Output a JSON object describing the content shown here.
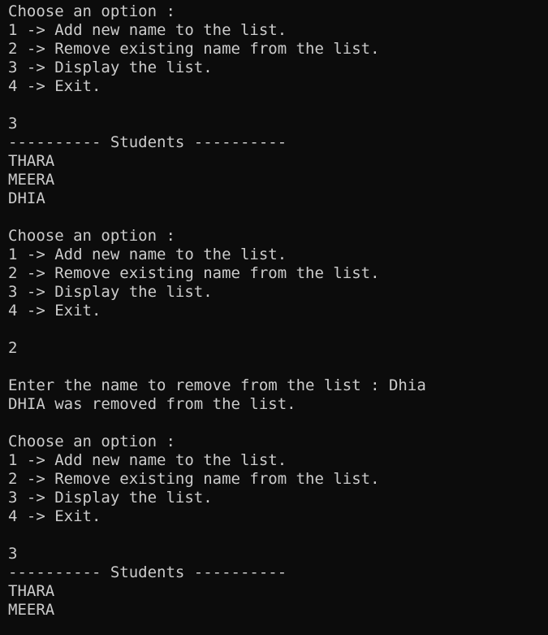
{
  "terminal": {
    "lines": [
      "Choose an option :",
      "1 -> Add new name to the list.",
      "2 -> Remove existing name from the list.",
      "3 -> Display the list.",
      "4 -> Exit.",
      "",
      "3",
      "---------- Students ----------",
      "THARA",
      "MEERA",
      "DHIA",
      "",
      "Choose an option :",
      "1 -> Add new name to the list.",
      "2 -> Remove existing name from the list.",
      "3 -> Display the list.",
      "4 -> Exit.",
      "",
      "2",
      "",
      "Enter the name to remove from the list : Dhia",
      "DHIA was removed from the list.",
      "",
      "Choose an option :",
      "1 -> Add new name to the list.",
      "2 -> Remove existing name from the list.",
      "3 -> Display the list.",
      "4 -> Exit.",
      "",
      "3",
      "---------- Students ----------",
      "THARA",
      "MEERA"
    ]
  }
}
